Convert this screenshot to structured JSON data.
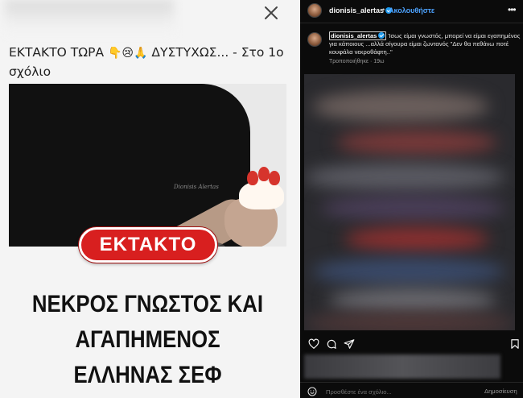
{
  "article": {
    "headline_text": "ΕΚΤΑΚΤΟ ΤΩΡΑ",
    "headline_emojis": "👇😢🙏",
    "headline_rest": "ΔΥΣΤΥΧΩΣ... - Στο 1ο σχόλιο",
    "photo_brand": "Dionisis Alertas",
    "badge": "ΕΚΤΑΚΤΟ",
    "big_lines": [
      "ΝΕΚΡΟΣ ΓΝΩΣΤΟΣ ΚΑΙ",
      "ΑΓΑΠΗΜΕΝΟΣ",
      "ΕΛΛΗΝΑΣ ΣΕΦ"
    ],
    "close_icon": "close-icon"
  },
  "post": {
    "username": "dionisis_alertas",
    "dot": "•",
    "follow": "Ακολουθήστε",
    "more": "•••",
    "caption_user": "dionisis_alertas",
    "caption_text": "Ίσως είμαι γνωστός, μπορεί να είμαι εγαπημένος για κάποιους ...αλλά σίγουρα είμαι ζωντανός \"Δεν θα πεθάνω ποτέ κουφάλα νεκροθάφτη..\"",
    "caption_meta": "Τροποποιήθηκε · 19ω",
    "comment_placeholder": "Προσθέστε ένα σχόλιο...",
    "post_button": "Δημοσίευση",
    "icons": [
      "heart-icon",
      "comment-icon",
      "share-icon",
      "bookmark-icon",
      "emoji-icon",
      "verified-icon",
      "more-icon"
    ]
  },
  "colors": {
    "badge_red": "#d81f1f",
    "follow_blue": "#4da3ff",
    "verified_blue": "#1d9bf0",
    "dark_bg": "#0b0b0b"
  }
}
